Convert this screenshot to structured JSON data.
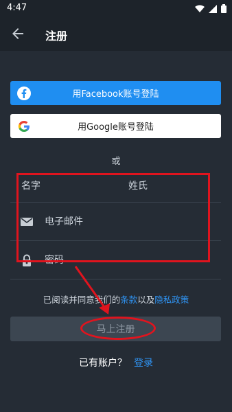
{
  "status_bar": {
    "time": "4:47"
  },
  "appbar": {
    "title": "注册"
  },
  "social": {
    "facebook_label": "用Facebook账号登陆",
    "google_label": "用Google账号登陆"
  },
  "divider_text": "或",
  "form": {
    "first_name_label": "名字",
    "last_name_label": "姓氏",
    "email_placeholder": "电子邮件",
    "password_placeholder": "密码"
  },
  "terms": {
    "prefix": "已阅读并同意我们的",
    "terms_link": "条款",
    "middle": "以及",
    "privacy_link": "隐私政策"
  },
  "signup_button": "马上注册",
  "login": {
    "prompt": "已有账户？",
    "link": "登录"
  },
  "colors": {
    "background": "#252c35",
    "facebook_blue": "#1f8ef1",
    "link_blue": "#2f93f2",
    "annotation_red": "#e0141e"
  }
}
